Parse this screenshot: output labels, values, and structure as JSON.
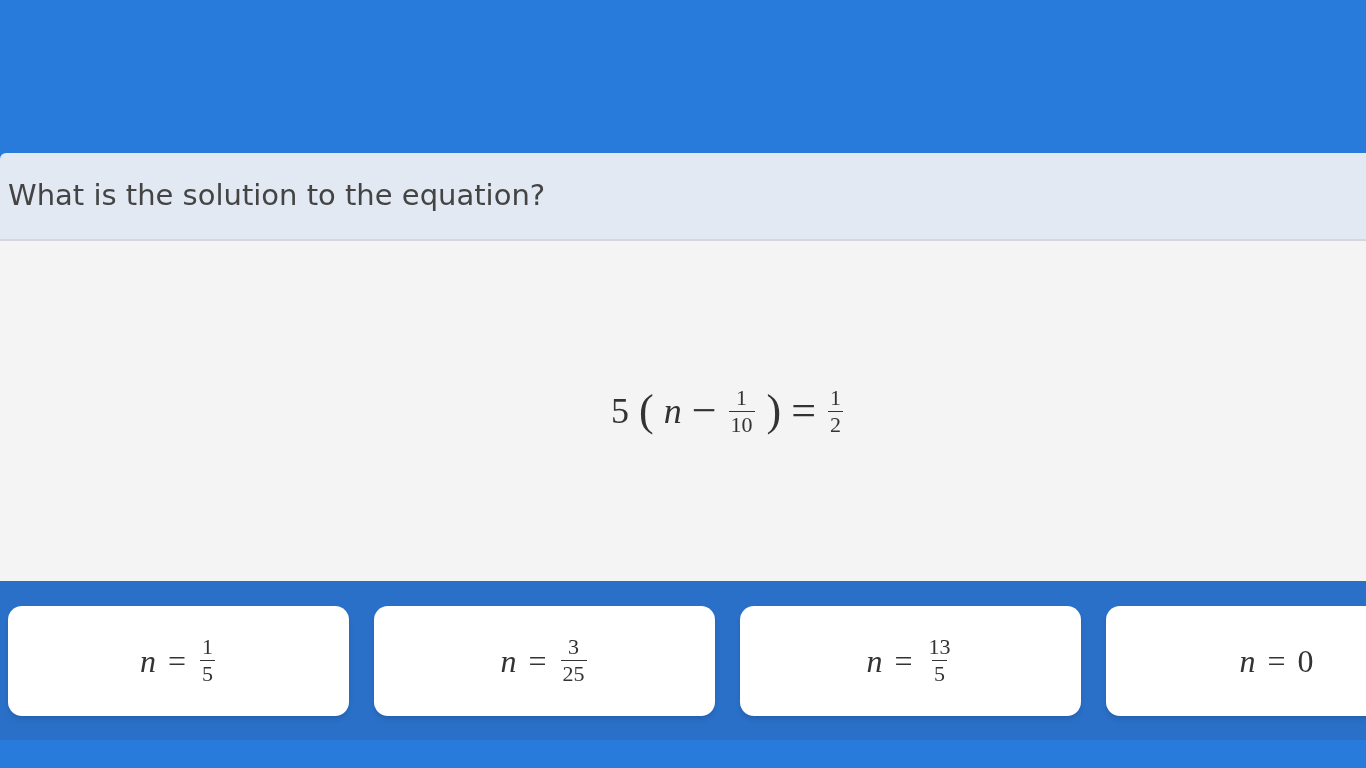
{
  "question": {
    "title": "What is the solution to the equation?"
  },
  "equation": [
    {
      "kind": "num",
      "text": "5"
    },
    {
      "kind": "op",
      "text": "("
    },
    {
      "kind": "var",
      "text": "n"
    },
    {
      "kind": "op",
      "text": "−"
    },
    {
      "kind": "frac",
      "num": "1",
      "den": "10"
    },
    {
      "kind": "op",
      "text": ")"
    },
    {
      "kind": "op",
      "text": "="
    },
    {
      "kind": "frac",
      "num": "1",
      "den": "2"
    }
  ],
  "answers": [
    {
      "tokens": [
        {
          "kind": "var",
          "text": "n"
        },
        {
          "kind": "op",
          "text": "="
        },
        {
          "kind": "frac",
          "num": "1",
          "den": "5"
        }
      ]
    },
    {
      "tokens": [
        {
          "kind": "var",
          "text": "n"
        },
        {
          "kind": "op",
          "text": "="
        },
        {
          "kind": "frac",
          "num": "3",
          "den": "25"
        }
      ]
    },
    {
      "tokens": [
        {
          "kind": "var",
          "text": "n"
        },
        {
          "kind": "op",
          "text": "="
        },
        {
          "kind": "frac",
          "num": "13",
          "den": "5"
        }
      ]
    },
    {
      "tokens": [
        {
          "kind": "var",
          "text": "n"
        },
        {
          "kind": "op",
          "text": "="
        },
        {
          "kind": "num",
          "text": "0"
        }
      ]
    }
  ]
}
